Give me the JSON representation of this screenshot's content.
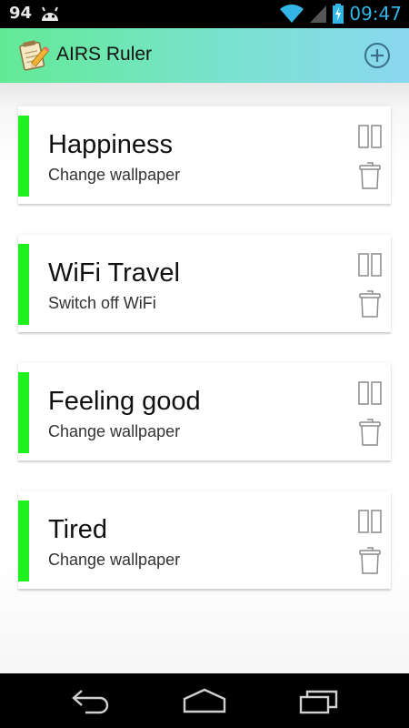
{
  "status_bar": {
    "left_number": "94",
    "time": "09:47",
    "icons": [
      "android-icon",
      "wifi-icon",
      "signal-icon",
      "battery-charging-icon"
    ]
  },
  "action_bar": {
    "title": "AIRS Ruler",
    "app_icon": "notepad-pencil-icon",
    "add_icon": "add-circle-icon"
  },
  "rules": [
    {
      "title": "Happiness",
      "action": "Change wallpaper",
      "status_color": "#1ff01f"
    },
    {
      "title": "WiFi Travel",
      "action": "Switch off WiFi",
      "status_color": "#1ff01f"
    },
    {
      "title": "Feeling good",
      "action": "Change wallpaper",
      "status_color": "#1ff01f"
    },
    {
      "title": "Tired",
      "action": "Change wallpaper",
      "status_color": "#1ff01f"
    }
  ],
  "navigation": {
    "icons": [
      "back-icon",
      "home-icon",
      "recent-apps-icon"
    ]
  },
  "colors": {
    "accent_clock": "#33b5e5",
    "actionbar_gradient_start": "#62ea95",
    "actionbar_gradient_end": "#8ad7ef",
    "rule_active": "#1ff01f"
  }
}
